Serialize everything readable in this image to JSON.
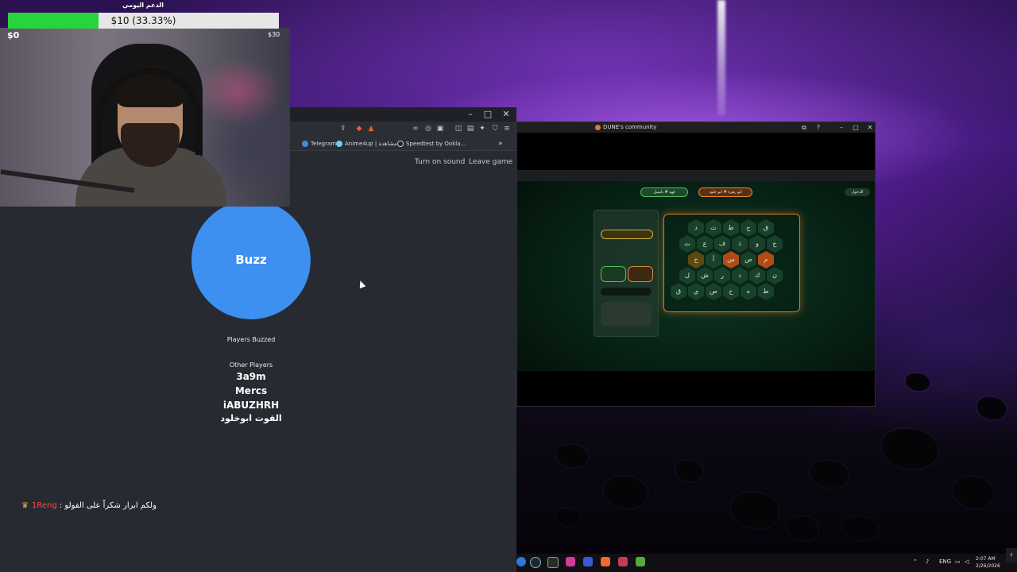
{
  "donation": {
    "title": "الدعم اليومي",
    "label": "$10 (33.33%)",
    "progress": 0.3333,
    "min": "$0",
    "max": "$30",
    "fill_color": "#27d43c"
  },
  "browser": {
    "bookmarks": [
      {
        "label": "Telegram"
      },
      {
        "label": "Anime4up | مشاهدة..."
      },
      {
        "label": "Speedtest by Ookla..."
      }
    ],
    "overflow": "»"
  },
  "game": {
    "turn_on_sound": "Turn on sound",
    "leave_game": "Leave game",
    "buzz_label": "Buzz",
    "buzz_color": "#3d8ff0",
    "players_buzzed": "Players Buzzed",
    "other_players_title": "Other Players",
    "other_players": [
      "3a9m",
      "Mercs",
      "iABUZHRH",
      "القوت ابوخلود"
    ]
  },
  "chat": {
    "user": "1Reng",
    "separator": " : ",
    "message": "ولكم ابرار شكراً على الفولو"
  },
  "discord": {
    "title": "DUNE's community",
    "accent": "#e8762a"
  },
  "stream": {
    "team_left": "فهد # باسيل",
    "team_right": "ابو زهرة # ابو خلود",
    "back": "الدخول",
    "hexes": [
      "ق",
      "ح",
      "ط",
      "ث",
      "د",
      "خ",
      "و",
      "ذ",
      "ف",
      "ع",
      "ت",
      "م",
      "ص",
      "س",
      "أ",
      "خ",
      "ن",
      "ك",
      "د",
      "ر",
      "ش",
      "ل",
      "ط",
      "ه",
      "خ",
      "ص",
      "ي"
    ]
  },
  "taskbar": {
    "lang": "ENG",
    "time": "2:07 AM",
    "date": "2/26/2026"
  }
}
